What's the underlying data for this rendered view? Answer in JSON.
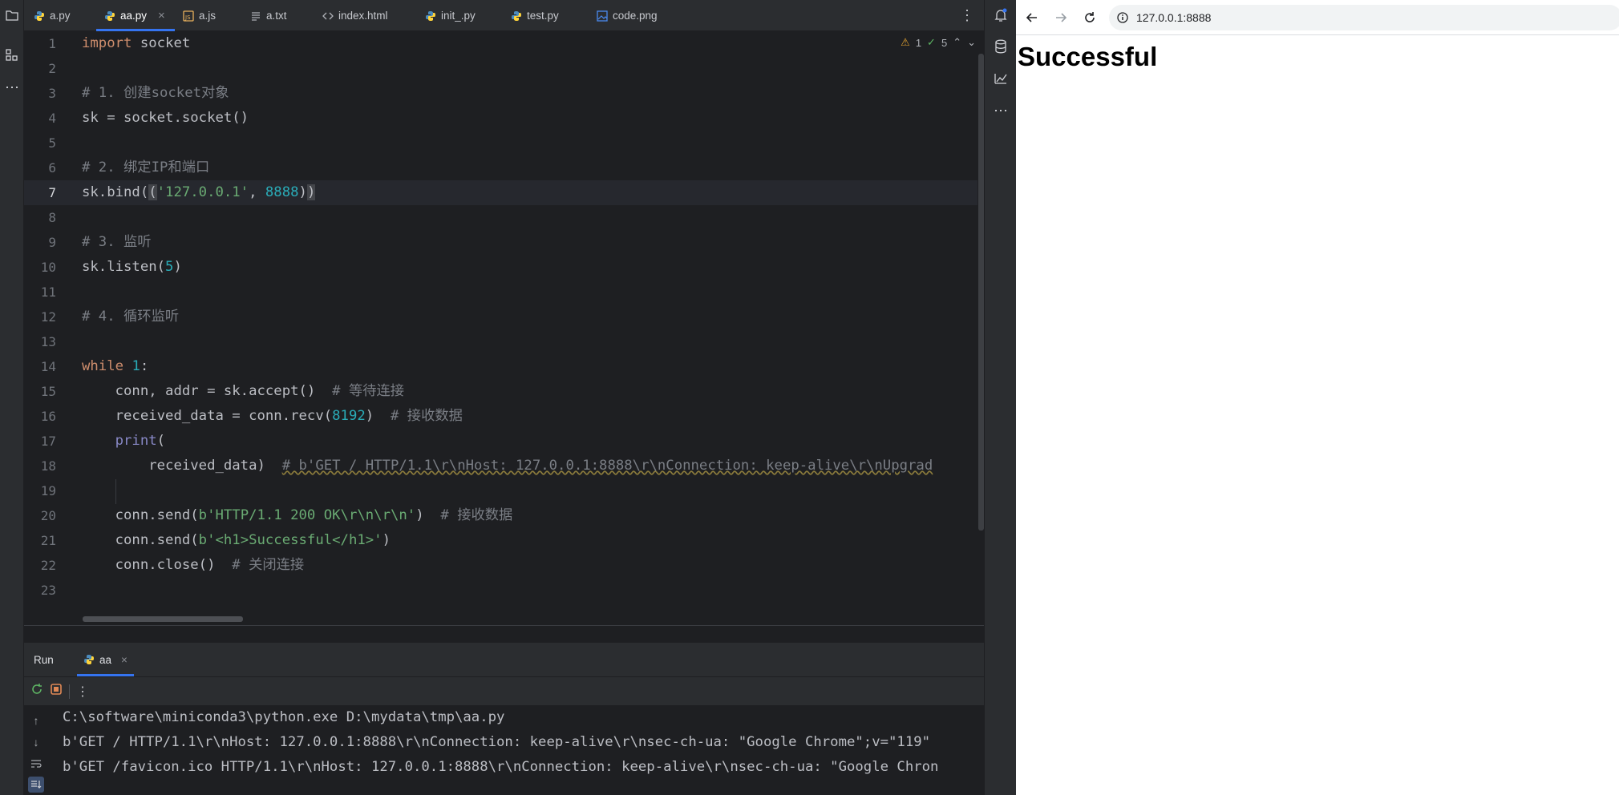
{
  "ide": {
    "tabs": [
      {
        "label": "a.py",
        "icon": "python-file-icon"
      },
      {
        "label": "aa.py",
        "icon": "python-file-icon",
        "active": true,
        "close": "×"
      },
      {
        "label": "a.js",
        "icon": "js-file-icon"
      },
      {
        "label": "a.txt",
        "icon": "text-file-icon"
      },
      {
        "label": "index.html",
        "icon": "html-file-icon"
      },
      {
        "label": "init_.py",
        "icon": "python-file-icon"
      },
      {
        "label": "test.py",
        "icon": "python-file-icon"
      },
      {
        "label": "code.png",
        "icon": "image-file-icon"
      }
    ],
    "more_tabs": "⋮",
    "inspection": {
      "warnings": "1",
      "checks": "5"
    },
    "line_numbers": [
      "1",
      "2",
      "3",
      "4",
      "5",
      "6",
      "7",
      "8",
      "9",
      "10",
      "11",
      "12",
      "13",
      "14",
      "15",
      "16",
      "17",
      "18",
      "19",
      "20",
      "21",
      "22",
      "23"
    ],
    "current_line": "7",
    "code": {
      "l1_kw": "import",
      "l1_rest": " socket",
      "l3": "# 1. 创建socket对象",
      "l4": "sk = socket.socket()",
      "l6": "# 2. 绑定IP和端口",
      "l7_a": "sk.bind(",
      "l7_b": "(",
      "l7_str": "'127.0.0.1'",
      "l7_c": ", ",
      "l7_num": "8888",
      "l7_d": ")",
      "l7_e": ")",
      "l9": "# 3. 监听",
      "l10_a": "sk.listen(",
      "l10_num": "5",
      "l10_b": ")",
      "l12": "# 4. 循环监听",
      "l14_kw": "while",
      "l14_sp": " ",
      "l14_num": "1",
      "l14_rest": ":",
      "l15_code": "    conn, addr = sk.accept()  ",
      "l15_cm": "# 等待连接",
      "l16_a": "    received_data = conn.recv(",
      "l16_num": "8192",
      "l16_b": ")  ",
      "l16_cm": "# 接收数据",
      "l17_ind": "    ",
      "l17_bi": "print",
      "l17_rest": "(",
      "l18_code": "        received_data)  ",
      "l18_cm": "# b'GET / HTTP/1.1\\r\\nHost: 127.0.0.1:8888\\r\\nConnection: keep-alive\\r\\nUpgrad",
      "l20_a": "    conn.send(",
      "l20_str": "b'HTTP/1.1 200 OK\\r\\n\\r\\n'",
      "l20_b": ")  ",
      "l20_cm": "# 接收数据",
      "l21_a": "    conn.send(",
      "l21_str": "b'<h1>Successful</h1>'",
      "l21_b": ")",
      "l22_a": "    conn.close()  ",
      "l22_cm": "# 关闭连接"
    },
    "run": {
      "title": "Run",
      "tab_label": "aa",
      "tab_close": "×",
      "console": [
        "C:\\software\\miniconda3\\python.exe D:\\mydata\\tmp\\aa.py",
        "b'GET / HTTP/1.1\\r\\nHost: 127.0.0.1:8888\\r\\nConnection: keep-alive\\r\\nsec-ch-ua: \"Google Chrome\";v=\"119\"",
        "b'GET /favicon.ico HTTP/1.1\\r\\nHost: 127.0.0.1:8888\\r\\nConnection: keep-alive\\r\\nsec-ch-ua: \"Google Chron"
      ]
    }
  },
  "browser": {
    "url": "127.0.0.1:8888",
    "heading": "Successful"
  },
  "colors": {
    "accent": "#3574f0",
    "keyword": "#cf8e6d",
    "string": "#6aab73",
    "number": "#2aacb8",
    "comment": "#7a7e85"
  }
}
